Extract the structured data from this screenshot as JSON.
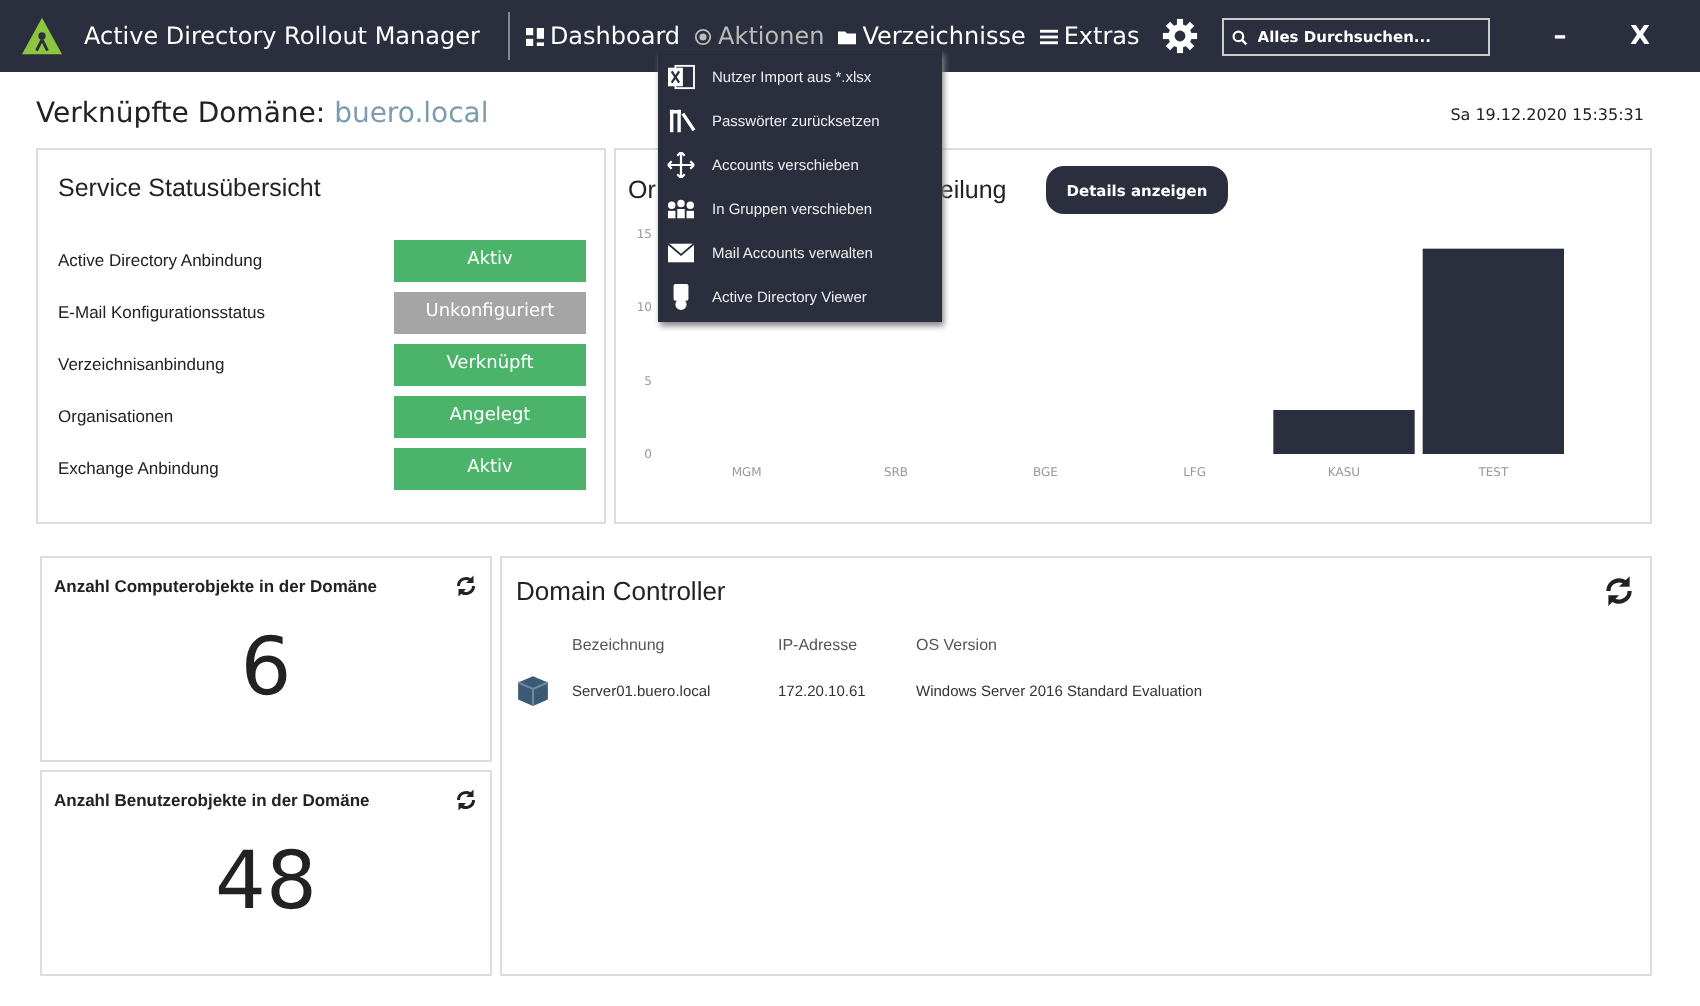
{
  "app": {
    "title": "Active Directory Rollout Manager"
  },
  "nav": [
    {
      "label": "Dashboard",
      "selected": false
    },
    {
      "label": "Aktionen",
      "selected": true
    },
    {
      "label": "Verzeichnisse",
      "selected": false
    },
    {
      "label": "Extras",
      "selected": false
    }
  ],
  "search": {
    "placeholder": "Alles Durchsuchen..."
  },
  "window_controls": [
    "–",
    "X"
  ],
  "actions_menu": [
    "Nutzer Import aus *.xlsx",
    "Passwörter zurücksetzen",
    "Accounts verschieben",
    "In Gruppen verschieben",
    "Mail Accounts verwalten",
    "Active Directory Viewer"
  ],
  "domain": {
    "label": "Verknüpfte Domäne:",
    "value": "buero.local",
    "datetime": "Sa 19.12.2020 15:35:31"
  },
  "service_status": {
    "title": "Service Statusübersicht",
    "rows": [
      {
        "label": "Active Directory Anbindung",
        "status": "Aktiv",
        "ok": true
      },
      {
        "label": "E-Mail Konfigurationsstatus",
        "status": "Unkonfiguriert",
        "ok": false
      },
      {
        "label": "Verzeichnisanbindung",
        "status": "Verknüpft",
        "ok": true
      },
      {
        "label": "Organisationen",
        "status": "Angelegt",
        "ok": true
      },
      {
        "label": "Exchange Anbindung",
        "status": "Aktiv",
        "ok": true
      }
    ]
  },
  "org_chart": {
    "title_start": "Or",
    "title_end": "eilung",
    "button": "Details anzeigen",
    "chart_data": {
      "type": "bar",
      "categories": [
        "MGM",
        "SRB",
        "BGE",
        "LFG",
        "KASU",
        "TEST"
      ],
      "values": [
        0,
        0,
        0,
        0,
        3,
        14
      ],
      "ylim": [
        0,
        15
      ],
      "yticks": [
        0,
        5,
        10,
        15
      ]
    }
  },
  "computer_count": {
    "title": "Anzahl Computerobjekte in der Domäne",
    "value": "6"
  },
  "user_count": {
    "title": "Anzahl Benutzerobjekte in der Domäne",
    "value": "48"
  },
  "domain_controller": {
    "title": "Domain Controller",
    "columns": [
      "Bezeichnung",
      "IP-Adresse",
      "OS Version"
    ],
    "rows": [
      [
        "Server01.buero.local",
        "172.20.10.61",
        "Windows Server 2016 Standard Evaluation"
      ]
    ]
  }
}
